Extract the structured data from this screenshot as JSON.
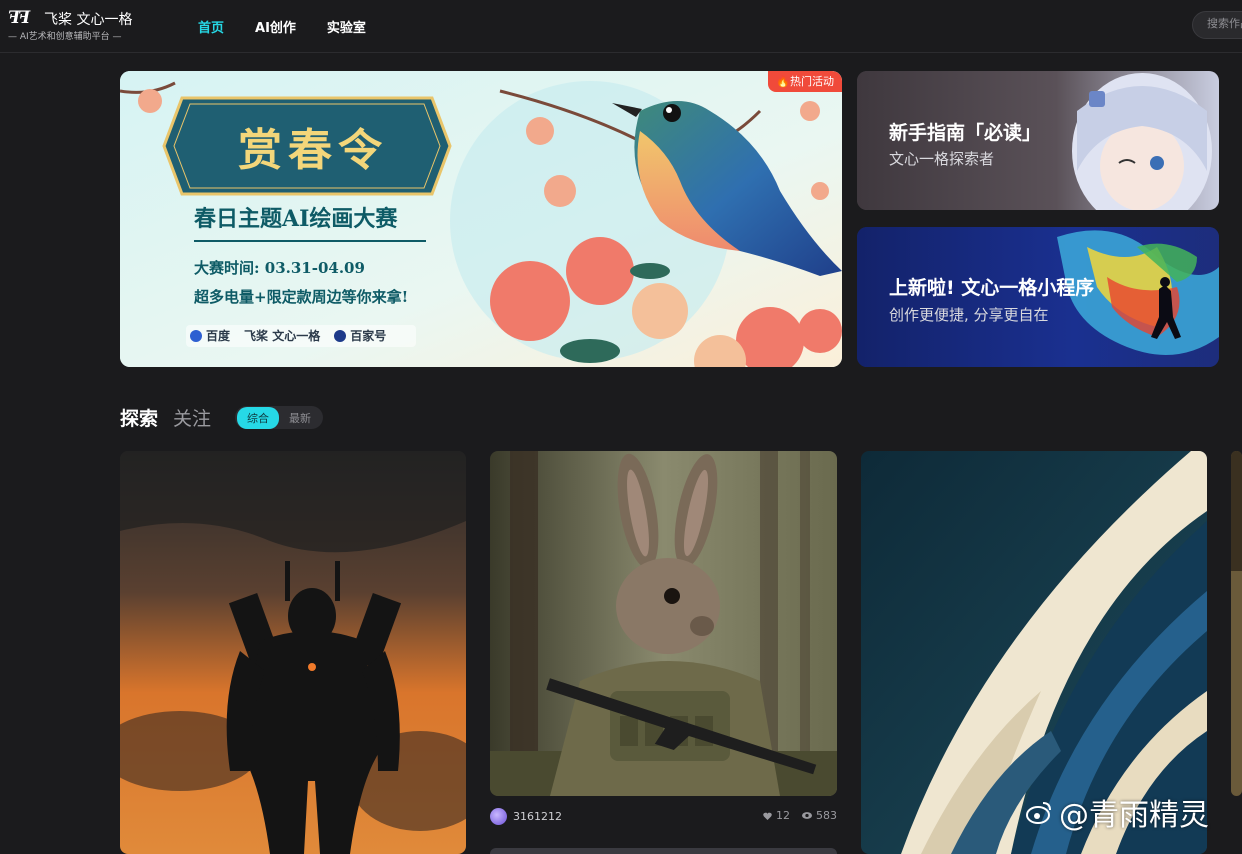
{
  "header": {
    "logo_mark": "ꟻꟻ",
    "logo_name": "飞桨 文心一格",
    "logo_sub": "— AI艺术和创意辅助平台 —",
    "nav": [
      "首页",
      "AI创作",
      "实验室"
    ],
    "search_placeholder": "搜索作品"
  },
  "banner_main": {
    "badge": "🔥热门活动",
    "sign_title": "赏春令",
    "title": "春日主题AI绘画大赛",
    "date": "大赛时间: 03.31-04.09",
    "prize": "超多电量+限定款周边等你来拿!",
    "sponsors": [
      "百度",
      "飞桨 文心一格",
      "百家号"
    ]
  },
  "banner_side": [
    {
      "title": "新手指南「必读」",
      "subtitle": "文心一格探索者"
    },
    {
      "title": "上新啦! 文心一格小程序",
      "subtitle": "创作更便捷, 分享更自在"
    }
  ],
  "explore": {
    "tabs": [
      "探索",
      "关注"
    ],
    "sort": [
      "综合",
      "最新"
    ]
  },
  "cards": [
    {
      "author": "3161212",
      "likes": "12",
      "views": "583"
    }
  ],
  "watermark": "@青雨精灵",
  "colors": {
    "accent": "#26d9e6",
    "background": "#1b1b1d",
    "badge": "#f04a3a"
  }
}
